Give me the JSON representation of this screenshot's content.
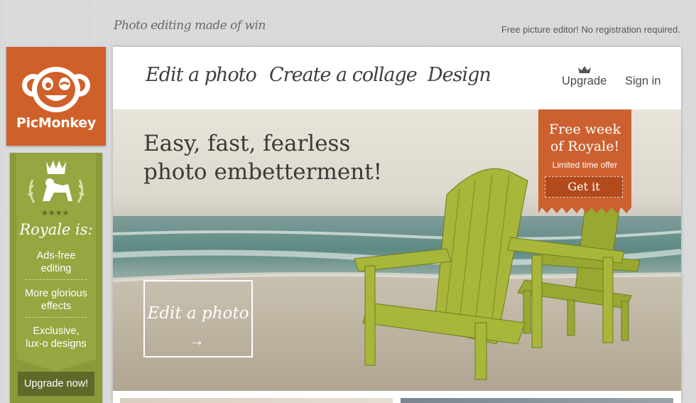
{
  "tagline": "Photo editing made of win",
  "top_note": "Free picture editor! No registration required.",
  "logo": {
    "name": "PicMonkey"
  },
  "sidebar": {
    "title": "Royale is:",
    "features": [
      "Ads-free editing",
      "More glorious effects",
      "Exclusive, lux-o designs"
    ],
    "upgrade_button": "Upgrade now!"
  },
  "nav": {
    "items": [
      "Edit a photo",
      "Create a collage",
      "Design"
    ],
    "upgrade": "Upgrade",
    "sign_in": "Sign in"
  },
  "hero": {
    "title_line1": "Easy, fast, fearless",
    "title_line2": "photo embetterment!",
    "edit_box": "Edit a photo",
    "edit_arrow": "→"
  },
  "promo": {
    "line1": "Free week",
    "line2": "of Royale!",
    "subtitle": "Limited time offer",
    "button": "Get it"
  },
  "colors": {
    "brand_orange": "#d0602a",
    "sidebar_green": "#8a9a3a",
    "chair_green": "#a8b63a"
  }
}
